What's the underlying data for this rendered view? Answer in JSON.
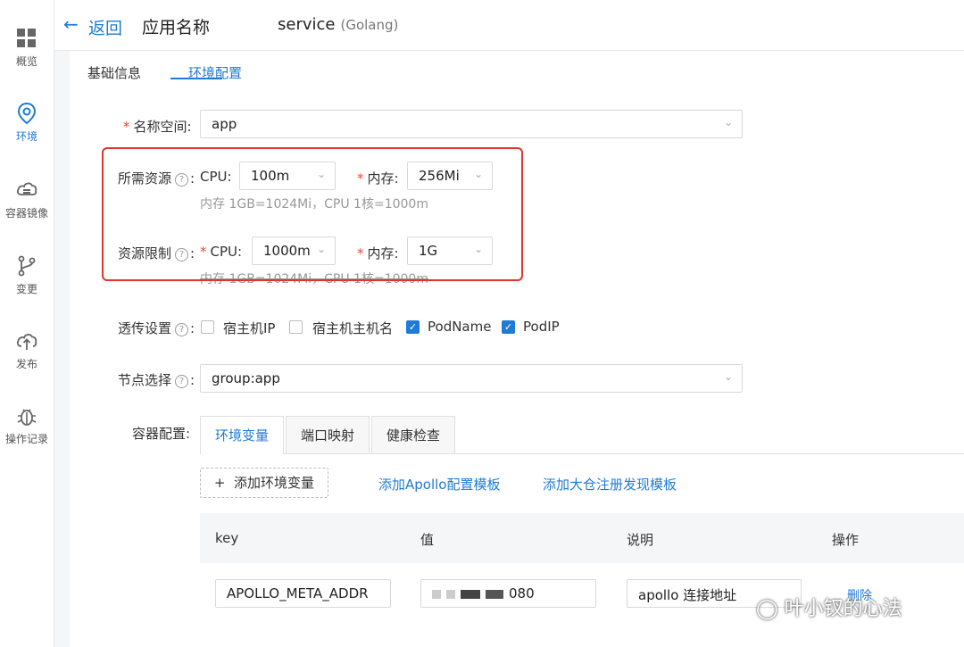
{
  "sidebar": {
    "items": [
      {
        "label": "概览",
        "icon": "grid-icon"
      },
      {
        "label": "环境",
        "icon": "location-pin-icon",
        "active": true
      },
      {
        "label": "容器镜像",
        "icon": "cloud-database-icon"
      },
      {
        "label": "变更",
        "icon": "branch-icon"
      },
      {
        "label": "发布",
        "icon": "cloud-upload-icon"
      },
      {
        "label": "操作记录",
        "icon": "bug-icon"
      }
    ]
  },
  "header": {
    "back_label": "返回",
    "app_name": "应用名称",
    "service_name": "service",
    "service_lang": "(Golang)"
  },
  "tabs": [
    "基础信息",
    "环境配置"
  ],
  "form": {
    "namespace": {
      "label": "名称空间:",
      "value": "app"
    },
    "requests": {
      "label": "所需资源",
      "cpu_label": "CPU:",
      "cpu_value": "100m",
      "mem_label": "内存:",
      "mem_value": "256Mi",
      "hint": "内存 1GB=1024Mi，CPU 1核=1000m"
    },
    "limits": {
      "label": "资源限制",
      "cpu_label": "CPU:",
      "cpu_value": "1000m",
      "mem_label": "内存:",
      "mem_value": "1G",
      "hint": "内存 1GB=1024Mi，CPU 1核=1000m"
    },
    "passthrough": {
      "label": "透传设置",
      "options": [
        {
          "label": "宿主机IP",
          "checked": false
        },
        {
          "label": "宿主机主机名",
          "checked": false
        },
        {
          "label": "PodName",
          "checked": true
        },
        {
          "label": "PodIP",
          "checked": true
        }
      ]
    },
    "node_select": {
      "label": "节点选择",
      "value": "group:app"
    },
    "container": {
      "label": "容器配置:",
      "tabs": [
        "环境变量",
        "端口映射",
        "健康检查"
      ],
      "add_env_label": "添加环境变量",
      "add_apollo_link": "添加Apollo配置模板",
      "add_registry_link": "添加大仓注册发现模板",
      "columns": [
        "key",
        "值",
        "说明",
        "操作"
      ],
      "rows": [
        {
          "key": "APOLLO_META_ADDR",
          "value_suffix": "080",
          "desc": "apollo 连接地址",
          "action": "删除"
        }
      ]
    }
  },
  "watermark": "叶小钗的心法",
  "colors": {
    "accent": "#1f7bd6",
    "highlight_box": "#e0352b",
    "required": "#e74c3c"
  }
}
